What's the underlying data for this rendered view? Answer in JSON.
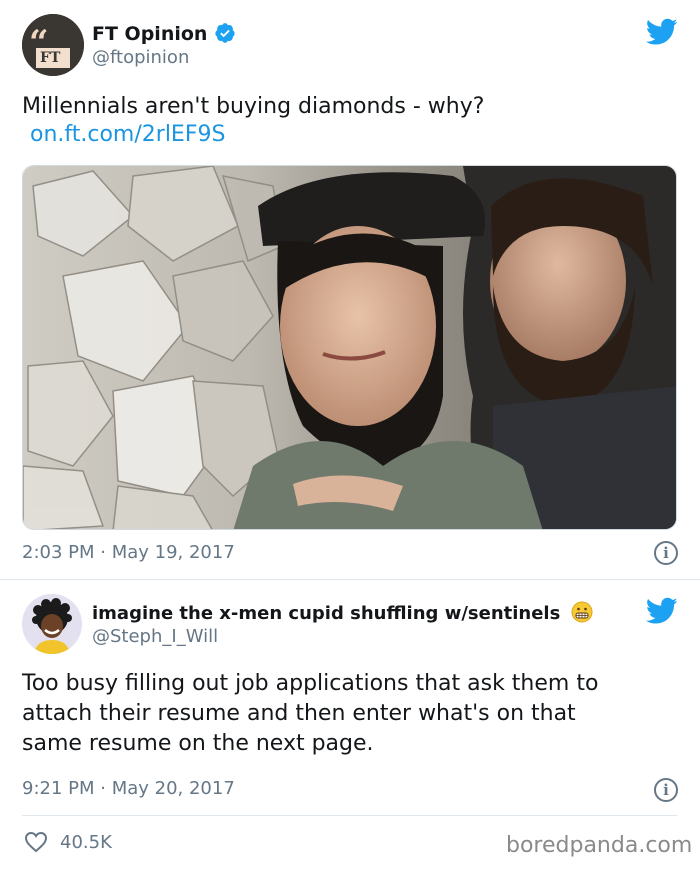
{
  "tweet1": {
    "display_name": "FT Opinion",
    "handle": "@ftopinion",
    "avatar_text": "FT",
    "text": "Millennials aren't buying diamonds - why?",
    "link": "on.ft.com/2rlEF9S",
    "timestamp": "2:03 PM · May 19, 2017"
  },
  "tweet2": {
    "display_name": "imagine the x-men cupid shuffling w/sentinels",
    "handle": "@Steph_I_Will",
    "text_lines": [
      "Too busy filling out job applications that ask them to",
      "attach their resume and then enter what's on that",
      "same resume on the next page."
    ],
    "timestamp": "9:21 PM · May 20, 2017",
    "likes": "40.5K"
  },
  "watermark": "boredpanda.com",
  "colors": {
    "link": "#1b95e0",
    "twitter_blue": "#1da1f2",
    "verified": "#1da1f2"
  }
}
